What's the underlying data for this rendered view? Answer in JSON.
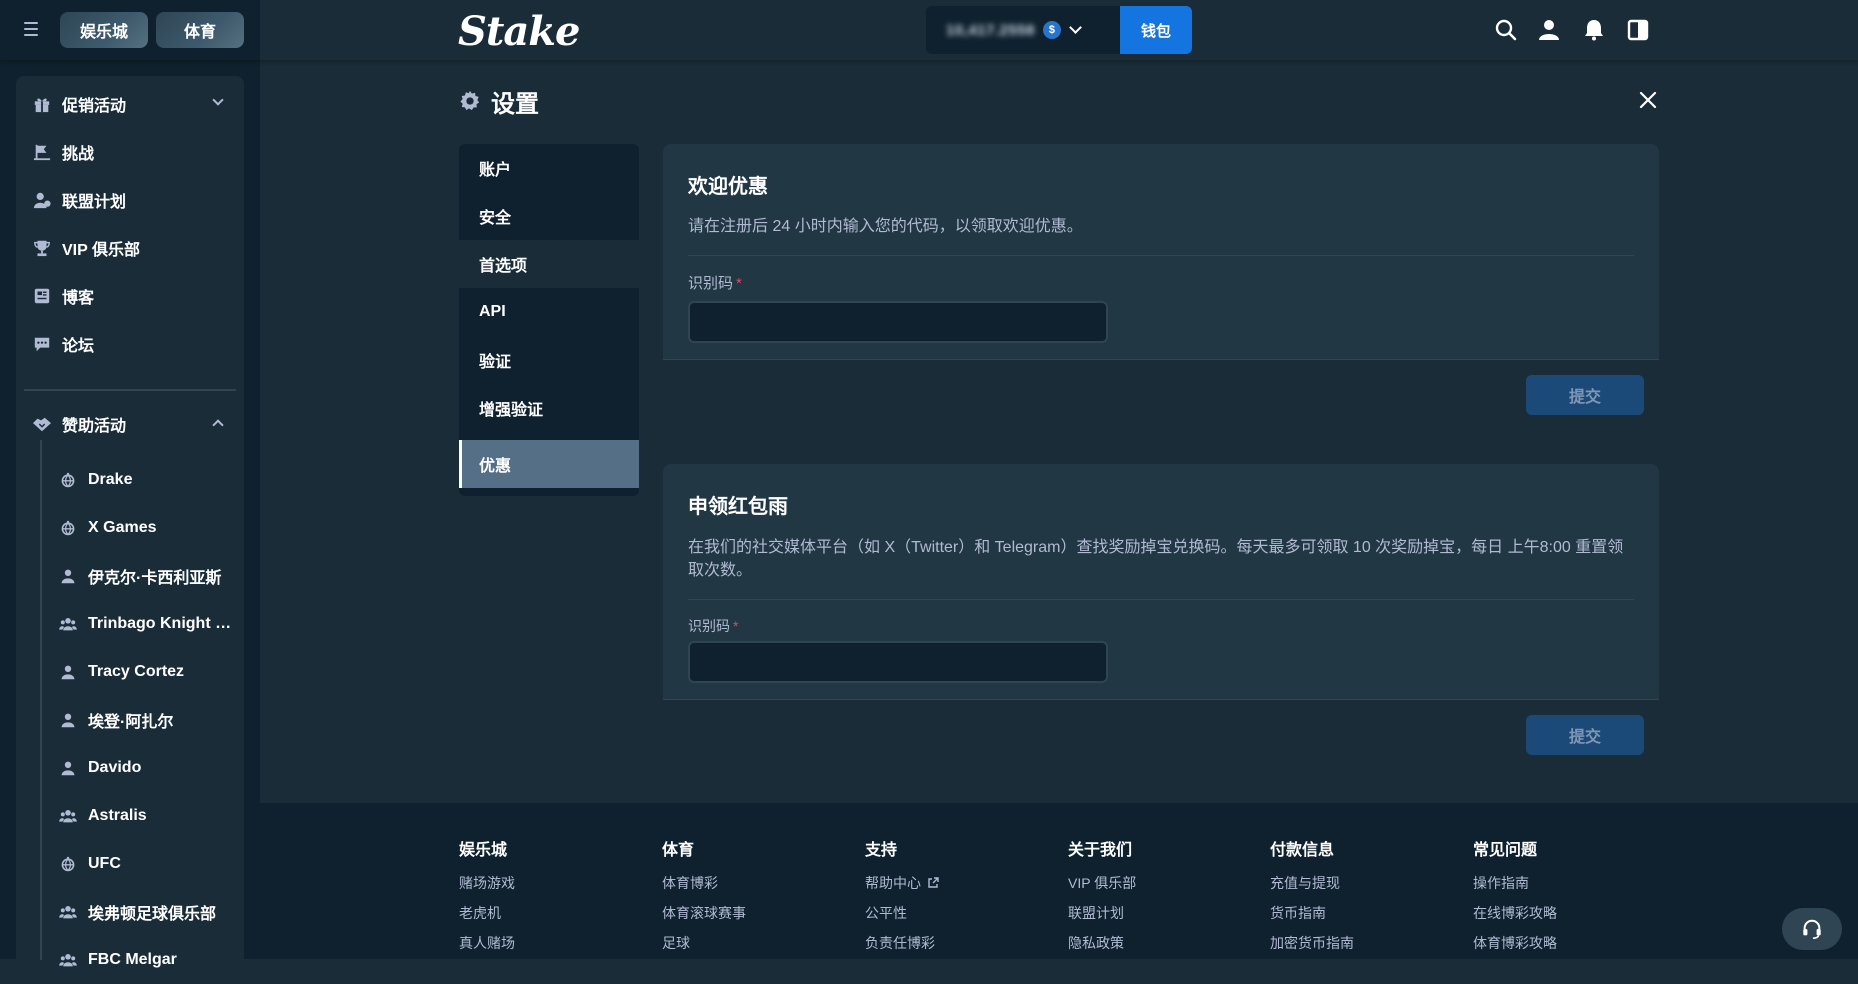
{
  "header": {
    "tabs": {
      "casino": "娱乐城",
      "sports": "体育"
    },
    "logo": "Stake",
    "balance": "10,417.2558",
    "currency_icon": "usdc-coin-icon",
    "wallet_label": "钱包",
    "icons": [
      "search-icon",
      "user-icon",
      "bell-icon",
      "sidebar-toggle-icon"
    ]
  },
  "sidebar": {
    "items": [
      {
        "label": "促销活动",
        "icon": "gift-icon",
        "expand": "collapsed"
      },
      {
        "label": "挑战",
        "icon": "challenge-icon"
      },
      {
        "label": "联盟计划",
        "icon": "affiliate-icon"
      },
      {
        "label": "VIP 俱乐部",
        "icon": "trophy-icon"
      },
      {
        "label": "博客",
        "icon": "blog-icon"
      },
      {
        "label": "论坛",
        "icon": "forum-icon"
      },
      {
        "label": "赞助活动",
        "icon": "handshake-icon",
        "expand": "expanded"
      }
    ],
    "sponsorships": [
      {
        "label": "Drake",
        "icon": "globe-icon"
      },
      {
        "label": "X Games",
        "icon": "globe-icon"
      },
      {
        "label": "伊克尔·卡西利亚斯",
        "icon": "person-icon"
      },
      {
        "label": "Trinbago Knight Riders",
        "icon": "team-icon"
      },
      {
        "label": "Tracy Cortez",
        "icon": "person-icon"
      },
      {
        "label": "埃登·阿扎尔",
        "icon": "person-icon"
      },
      {
        "label": "Davido",
        "icon": "person-icon"
      },
      {
        "label": "Astralis",
        "icon": "team-icon"
      },
      {
        "label": "UFC",
        "icon": "globe-icon"
      },
      {
        "label": "埃弗顿足球俱乐部",
        "icon": "team-icon"
      },
      {
        "label": "FBC Melgar",
        "icon": "team-icon"
      }
    ]
  },
  "settings": {
    "title": "设置",
    "nav": [
      "账户",
      "安全",
      "首选项",
      "API",
      "验证",
      "增强验证",
      "优惠"
    ],
    "active_nav": "优惠",
    "welcome": {
      "title": "欢迎优惠",
      "description": "请在注册后 24 小时内输入您的代码，以领取欢迎优惠。",
      "field_label": "识别码",
      "required_mark": "*",
      "value": "",
      "submit": "提交"
    },
    "rain": {
      "title": "申领红包雨",
      "description": "在我们的社交媒体平台（如 X（Twitter）和 Telegram）查找奖励掉宝兑换码。每天最多可领取 10 次奖励掉宝，每日 上午8:00 重置领取次数。",
      "field_label": "识别码",
      "required_mark": "*",
      "value": "",
      "submit": "提交"
    }
  },
  "footer": {
    "columns": [
      {
        "title": "娱乐城",
        "links": [
          "赌场游戏",
          "老虎机",
          "真人赌场"
        ]
      },
      {
        "title": "体育",
        "links": [
          "体育博彩",
          "体育滚球赛事",
          "足球"
        ]
      },
      {
        "title": "支持",
        "links": [
          "帮助中心",
          "公平性",
          "负责任博彩"
        ]
      },
      {
        "title": "关于我们",
        "links": [
          "VIP 俱乐部",
          "联盟计划",
          "隐私政策"
        ]
      },
      {
        "title": "付款信息",
        "links": [
          "充值与提现",
          "货币指南",
          "加密货币指南"
        ]
      },
      {
        "title": "常见问题",
        "links": [
          "操作指南",
          "在线博彩攻略",
          "体育博彩攻略"
        ]
      }
    ]
  },
  "colors": {
    "background": "#1a2c38",
    "sidebar": "#0f212e",
    "card": "#213743",
    "accent": "#1475e1",
    "submit_disabled": "#1c4a78",
    "active_nav": "#557086",
    "muted_text": "#b1bad3",
    "required": "#ed4163"
  }
}
